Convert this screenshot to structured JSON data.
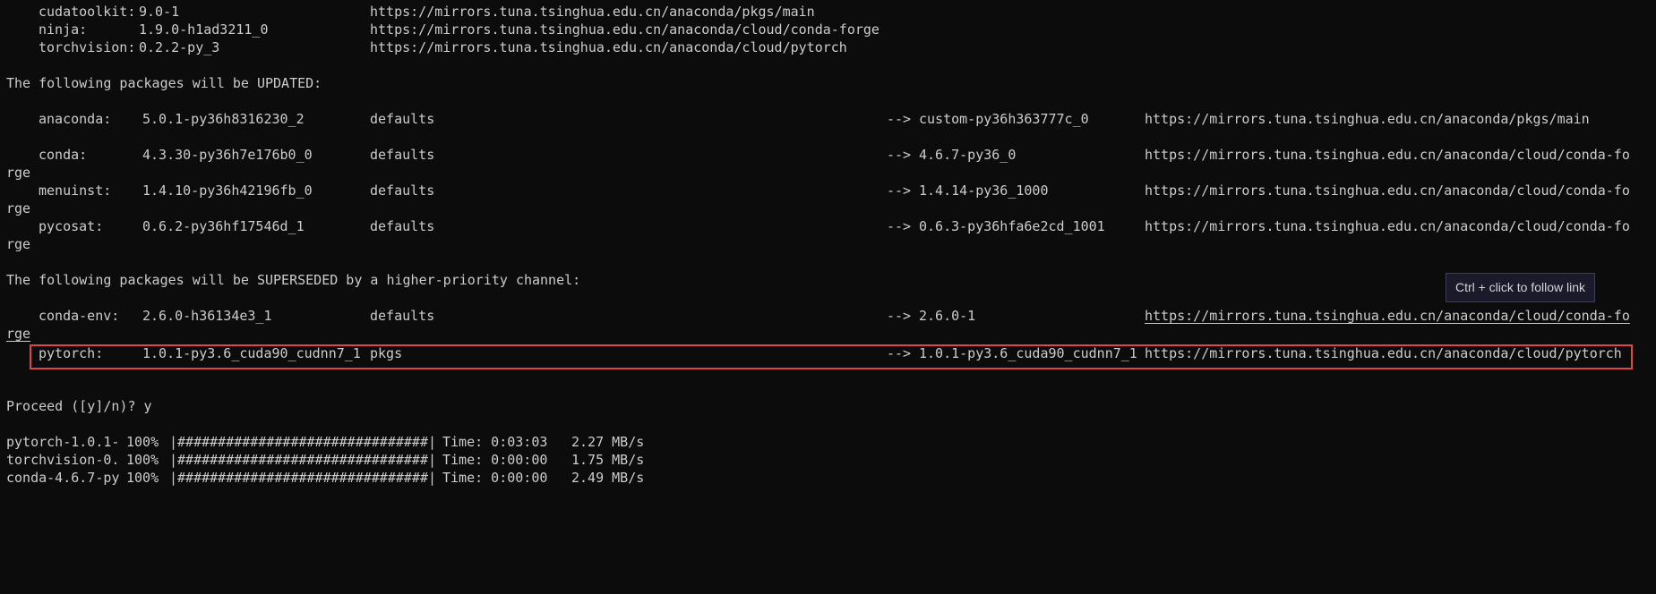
{
  "top_packages": [
    {
      "name": "cudatoolkit:",
      "version": "9.0-1",
      "url": "https://mirrors.tuna.tsinghua.edu.cn/anaconda/pkgs/main"
    },
    {
      "name": "ninja:",
      "version": "1.9.0-h1ad3211_0",
      "url": "https://mirrors.tuna.tsinghua.edu.cn/anaconda/cloud/conda-forge"
    },
    {
      "name": "torchvision:",
      "version": "0.2.2-py_3",
      "url": "https://mirrors.tuna.tsinghua.edu.cn/anaconda/cloud/pytorch"
    }
  ],
  "updated_header": "The following packages will be UPDATED:",
  "updated_packages": [
    {
      "name": "anaconda:",
      "old": "5.0.1-py36h8316230_2",
      "channel": "defaults",
      "arrow": "-->",
      "new": "custom-py36h363777c_0",
      "url": "https://mirrors.tuna.tsinghua.edu.cn/anaconda/pkgs/main",
      "wrap": ""
    },
    {
      "name": "conda:",
      "old": "4.3.30-py36h7e176b0_0",
      "channel": "defaults",
      "arrow": "-->",
      "new": "4.6.7-py36_0",
      "url": "https://mirrors.tuna.tsinghua.edu.cn/anaconda/cloud/conda-fo",
      "wrap": "rge"
    },
    {
      "name": "menuinst:",
      "old": "1.4.10-py36h42196fb_0",
      "channel": "defaults",
      "arrow": "-->",
      "new": "1.4.14-py36_1000",
      "url": "https://mirrors.tuna.tsinghua.edu.cn/anaconda/cloud/conda-fo",
      "wrap": "rge"
    },
    {
      "name": "pycosat:",
      "old": "0.6.2-py36hf17546d_1",
      "channel": "defaults",
      "arrow": "-->",
      "new": "0.6.3-py36hfa6e2cd_1001",
      "url": "https://mirrors.tuna.tsinghua.edu.cn/anaconda/cloud/conda-fo",
      "wrap": "rge"
    }
  ],
  "superseded_header": "The following packages will be SUPERSEDED by a higher-priority channel:",
  "superseded_packages": [
    {
      "name": "conda-env:",
      "old": "2.6.0-h36134e3_1",
      "channel": "defaults",
      "arrow": "-->",
      "new": "2.6.0-1",
      "url": "https://mirrors.tuna.tsinghua.edu.cn/anaconda/cloud/conda-fo",
      "wrap": "rge"
    },
    {
      "name": "pytorch:",
      "old": "1.0.1-py3.6_cuda90_cudnn7_1",
      "channel": "pkgs",
      "arrow": "-->",
      "new": "1.0.1-py3.6_cuda90_cudnn7_1",
      "url": "https://mirrors.tuna.tsinghua.edu.cn/anaconda/cloud/pytorch",
      "wrap": ""
    }
  ],
  "tooltip": "Ctrl + click to follow link",
  "proceed_prompt": "Proceed ([y]/n)? y",
  "downloads": [
    {
      "name": "pytorch-1.0.1-",
      "percent": "100%",
      "bar": "|###############################|",
      "time": "Time: 0:03:03",
      "speed": "2.27 MB/s"
    },
    {
      "name": "torchvision-0.",
      "percent": "100%",
      "bar": "|###############################|",
      "time": "Time: 0:00:00",
      "speed": "1.75 MB/s"
    },
    {
      "name": "conda-4.6.7-py",
      "percent": "100%",
      "bar": "|###############################|",
      "time": "Time: 0:00:00",
      "speed": "2.49 MB/s"
    }
  ],
  "colors": {
    "background": "#0c0c0c",
    "text": "#cccccc",
    "highlight_border": "#e04646"
  }
}
